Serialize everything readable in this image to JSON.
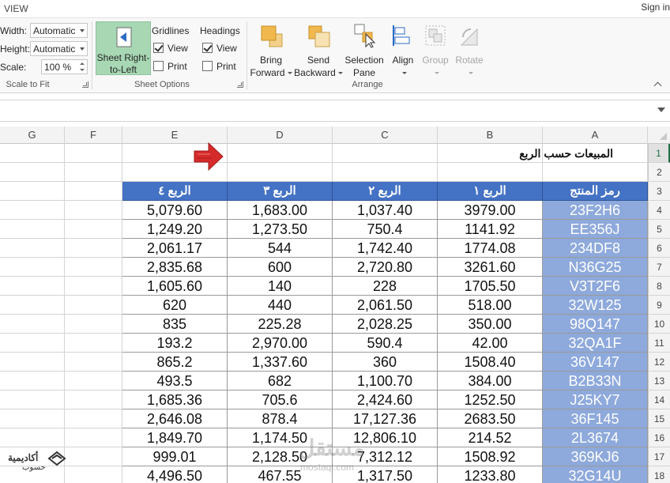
{
  "tabs": {
    "view": "VIEW",
    "sign_in": "Sign in"
  },
  "scale_to_fit": {
    "width_label": "Width:",
    "width_value": "Automatic",
    "height_label": "Height:",
    "height_value": "Automatic",
    "scale_label": "Scale:",
    "scale_value": "100 %",
    "group_label": "Scale to Fit"
  },
  "sheet_options": {
    "rtl_line1": "Sheet Right-",
    "rtl_line2": "to-Left",
    "gridlines": "Gridlines",
    "headings": "Headings",
    "view": "View",
    "print": "Print",
    "gridlines_view": true,
    "gridlines_print": false,
    "headings_view": true,
    "headings_print": false,
    "group_label": "Sheet Options"
  },
  "arrange": {
    "bring_1": "Bring",
    "bring_2": "Forward",
    "send_1": "Send",
    "send_2": "Backward",
    "sel_1": "Selection",
    "sel_2": "Pane",
    "align": "Align",
    "group": "Group",
    "rotate": "Rotate",
    "group_label": "Arrange"
  },
  "columns": [
    "G",
    "F",
    "E",
    "D",
    "C",
    "B",
    "A"
  ],
  "row_numbers": [
    "1",
    "2",
    "3",
    "4",
    "5",
    "6",
    "7",
    "8",
    "9",
    "10",
    "11",
    "12",
    "13",
    "14",
    "15",
    "16",
    "17",
    "18"
  ],
  "sheet_title": "المبيعات حسب الربع",
  "headers": {
    "code": "رمز المنتج",
    "q1": "الربع ١",
    "q2": "الربع ٢",
    "q3": "الربع ٣",
    "q4": "الربع ٤"
  },
  "rows": [
    {
      "code": "23F2H6",
      "q1": "3979.00",
      "q2": "1,037.40",
      "q3": "1,683.00",
      "q4": "5,079.60"
    },
    {
      "code": "EE356J",
      "q1": "1141.92",
      "q2": "750.4",
      "q3": "1,273.50",
      "q4": "1,249.20"
    },
    {
      "code": "234DF8",
      "q1": "1774.08",
      "q2": "1,742.40",
      "q3": "544",
      "q4": "2,061.17"
    },
    {
      "code": "N36G25",
      "q1": "3261.60",
      "q2": "2,720.80",
      "q3": "600",
      "q4": "2,835.68"
    },
    {
      "code": "V3T2F6",
      "q1": "1705.50",
      "q2": "228",
      "q3": "140",
      "q4": "1,605.60"
    },
    {
      "code": "32W125",
      "q1": "518.00",
      "q2": "2,061.50",
      "q3": "440",
      "q4": "620"
    },
    {
      "code": "98Q147",
      "q1": "350.00",
      "q2": "2,028.25",
      "q3": "225.28",
      "q4": "835"
    },
    {
      "code": "32QA1F",
      "q1": "42.00",
      "q2": "590.4",
      "q3": "2,970.00",
      "q4": "193.2"
    },
    {
      "code": "36V147",
      "q1": "1508.40",
      "q2": "360",
      "q3": "1,337.60",
      "q4": "865.2"
    },
    {
      "code": "B2B33N",
      "q1": "384.00",
      "q2": "1,100.70",
      "q3": "682",
      "q4": "493.5"
    },
    {
      "code": "J25KY7",
      "q1": "1252.50",
      "q2": "2,424.60",
      "q3": "705.6",
      "q4": "1,685.36"
    },
    {
      "code": "36F145",
      "q1": "2683.50",
      "q2": "17,127.36",
      "q3": "878.4",
      "q4": "2,646.08"
    },
    {
      "code": "2L3674",
      "q1": "214.52",
      "q2": "12,806.10",
      "q3": "1,174.50",
      "q4": "1,849.70"
    },
    {
      "code": "369KJ6",
      "q1": "1508.92",
      "q2": "7,312.12",
      "q3": "2,128.50",
      "q4": "999.01"
    },
    {
      "code": "32G14U",
      "q1": "1233.80",
      "q2": "1,317.50",
      "q3": "467.55",
      "q4": "4,496.50"
    }
  ],
  "watermark": {
    "brand": "أكاديمية",
    "sub": "حسوب",
    "logo_text": "مستقل",
    "url": "mostaql.com"
  },
  "colors": {
    "header_blue": "#4472c4",
    "code_blue": "#8ea9db",
    "rtl_button": "#a7d7b3",
    "arrow_red": "#d62b2b"
  }
}
